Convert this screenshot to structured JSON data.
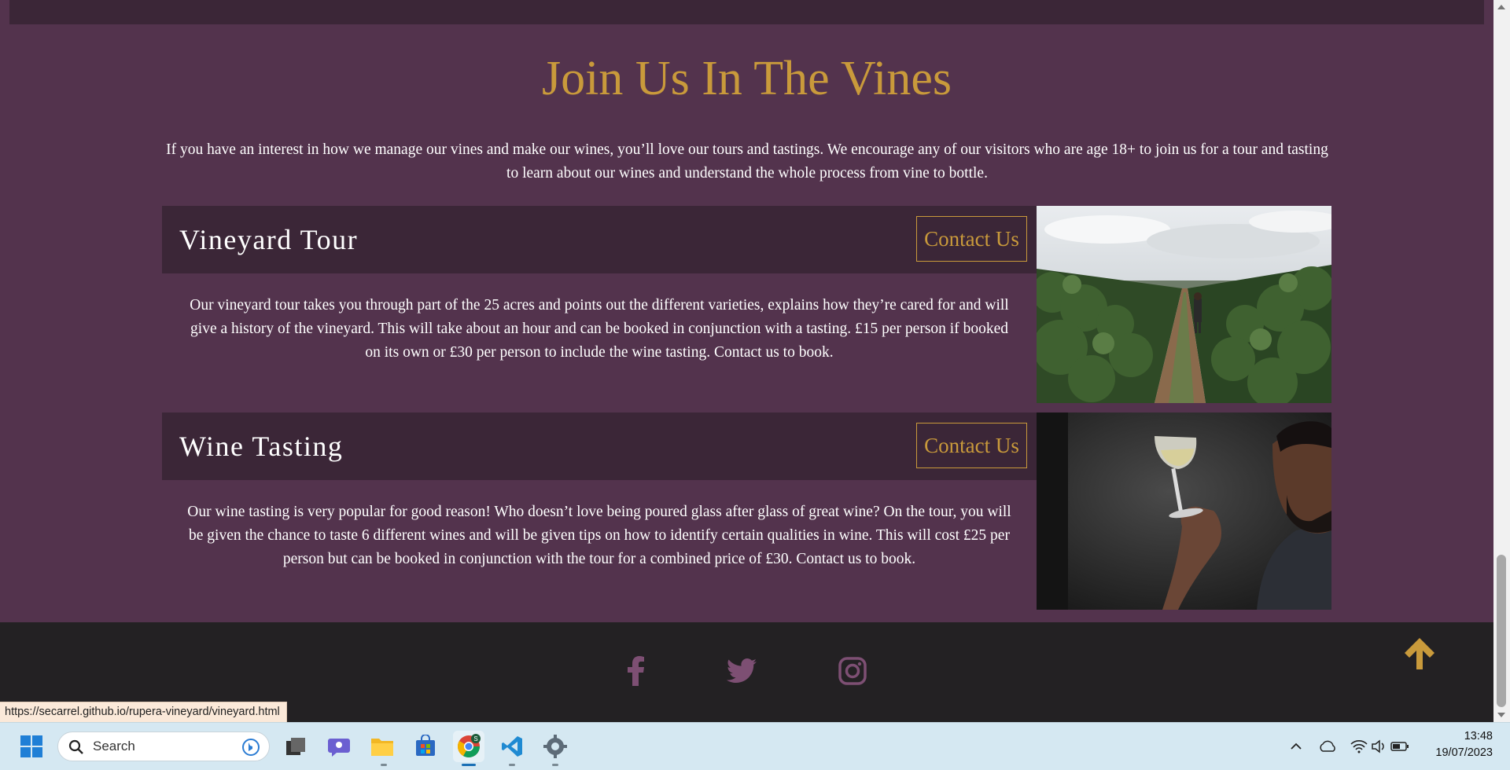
{
  "page": {
    "section_title": "Join Us In The Vines",
    "intro": "If you have an interest in how we manage our vines and make our wines, you’ll love our tours and tastings. We encourage any of our visitors who are age 18+ to join us for a tour and tasting to learn about our wines and understand the whole process from vine to bottle.",
    "cards": [
      {
        "title": "Vineyard Tour",
        "button": "Contact Us",
        "description": "Our vineyard tour takes you through part of the 25 acres and points out the different varieties, explains how they’re cared for and will give a history of the vineyard. This will take about an hour and can be booked in conjunction with a tasting. £15 per person if booked on its own or £30 per person to include the wine tasting. Contact us to book.",
        "image": "vineyard-rows-photo"
      },
      {
        "title": "Wine Tasting",
        "button": "Contact Us",
        "description": "Our wine tasting is very popular for good reason! Who doesn’t love being poured glass after glass of great wine? On the tour, you will be given the chance to taste 6 different wines and will be given tips on how to identify certain qualities in wine. This will cost £25 per person but can be booked in conjunction with the tour for a combined price of £30. Contact us to book.",
        "image": "man-holding-wine-glass-photo"
      }
    ],
    "footer": {
      "social": [
        "facebook-icon",
        "twitter-icon",
        "instagram-icon"
      ],
      "back_to_top_icon": "arrow-up-icon"
    }
  },
  "browser": {
    "status_url": "https://secarrel.github.io/rupera-vineyard/vineyard.html"
  },
  "taskbar": {
    "search_placeholder": "Search",
    "apps": [
      "start-icon",
      "search-icon",
      "task-view-icon",
      "chat-icon",
      "file-explorer-icon",
      "store-icon",
      "chrome-icon",
      "vscode-icon",
      "settings-icon"
    ],
    "time": "13:48",
    "date": "19/07/2023"
  },
  "colors": {
    "page_bg": "#53334d",
    "header_bg": "#3b2637",
    "accent_gold": "#c99a3b",
    "footer_bg": "#232123",
    "social_icon": "#7d4f73"
  }
}
